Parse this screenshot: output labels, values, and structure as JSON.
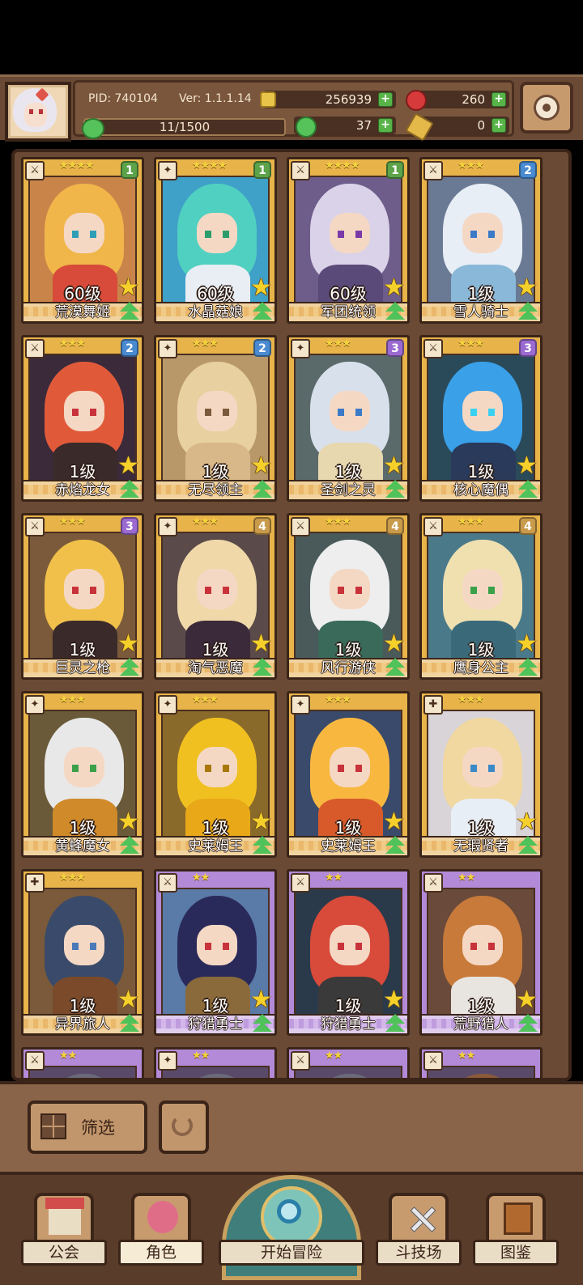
{
  "player": {
    "pid": "PID: 740104",
    "version": "Ver: 1.1.1.14",
    "stamina": "11/1500"
  },
  "resources": {
    "gold": "256939",
    "ruby": "260",
    "clover": "37",
    "key": "0"
  },
  "cards": [
    {
      "name": "荒漠舞姬",
      "level": "60级",
      "stars": "★★★★",
      "badge": "1",
      "badge_color": "#5da34a",
      "frame": "gold",
      "hair": "#f0b64a",
      "body": "#d84a3a",
      "eye": "#2f9fb8",
      "bg": "#c9844a",
      "icon": "⚔"
    },
    {
      "name": "水晶菇娘",
      "level": "60级",
      "stars": "★★★★",
      "badge": "1",
      "badge_color": "#5da34a",
      "frame": "gold",
      "hair": "#4fd0c0",
      "body": "#e8eef4",
      "eye": "#2a9d6a",
      "bg": "#3fa0c8",
      "icon": "✦"
    },
    {
      "name": "军团统领",
      "level": "60级",
      "stars": "★★★★",
      "badge": "1",
      "badge_color": "#5da34a",
      "frame": "gold",
      "hair": "#d9d2e8",
      "body": "#5a4a7a",
      "eye": "#7a3aa8",
      "bg": "#6e5d8a",
      "icon": "⚔"
    },
    {
      "name": "雪人骑士",
      "level": "1级",
      "stars": "★★★",
      "badge": "2",
      "badge_color": "#4a8ad0",
      "frame": "gold",
      "hair": "#e8eef6",
      "body": "#8ab8d8",
      "eye": "#3a7ac8",
      "bg": "#6a7a94",
      "icon": "⚔"
    },
    {
      "name": "赤焰龙女",
      "level": "1级",
      "stars": "★★★",
      "badge": "2",
      "badge_color": "#4a8ad0",
      "frame": "gold",
      "hair": "#e05a3a",
      "body": "#3a2a2a",
      "eye": "#c8323a",
      "bg": "#3a2a3a",
      "icon": "⚔"
    },
    {
      "name": "无尽领主",
      "level": "1级",
      "stars": "★★★",
      "badge": "2",
      "badge_color": "#4a8ad0",
      "frame": "gold",
      "hair": "#e8d0a0",
      "body": "#d8b888",
      "eye": "#7a5a3a",
      "bg": "#b89868",
      "icon": "✦"
    },
    {
      "name": "圣剑之灵",
      "level": "1级",
      "stars": "★★★",
      "badge": "3",
      "badge_color": "#9a6ad0",
      "frame": "gold",
      "hair": "#d8e0ec",
      "body": "#e8d8b0",
      "eye": "#3a7ac8",
      "bg": "#5a6a6a",
      "icon": "✦"
    },
    {
      "name": "核心魔偶",
      "level": "1级",
      "stars": "★★★",
      "badge": "3",
      "badge_color": "#9a6ad0",
      "frame": "gold",
      "hair": "#3aa0e8",
      "body": "#2a3a5a",
      "eye": "#3ad0f0",
      "bg": "#2a4a5a",
      "icon": "⚔"
    },
    {
      "name": "巨灵之枪",
      "level": "1级",
      "stars": "★★★",
      "badge": "3",
      "badge_color": "#9a6ad0",
      "frame": "gold",
      "hair": "#f0c04a",
      "body": "#3a2a2a",
      "eye": "#c8323a",
      "bg": "#7a5a3a",
      "icon": "⚔"
    },
    {
      "name": "淘气恶魔",
      "level": "1级",
      "stars": "★★★",
      "badge": "4",
      "badge_color": "#c89a4a",
      "frame": "gold",
      "hair": "#f0d8a8",
      "body": "#3a2a3a",
      "eye": "#c8323a",
      "bg": "#5a4a4a",
      "icon": "✦"
    },
    {
      "name": "风行游侠",
      "level": "1级",
      "stars": "★★★",
      "badge": "4",
      "badge_color": "#c89a4a",
      "frame": "gold",
      "hair": "#eeeeee",
      "body": "#3a6a5a",
      "eye": "#c8323a",
      "bg": "#4a5a5a",
      "icon": "⚔"
    },
    {
      "name": "鹰身公主",
      "level": "1级",
      "stars": "★★★",
      "badge": "4",
      "badge_color": "#c89a4a",
      "frame": "gold",
      "hair": "#f0e0b0",
      "body": "#3a6a7a",
      "eye": "#3aa04a",
      "bg": "#4a7a8a",
      "icon": "⚔"
    },
    {
      "name": "黄蜂魔女",
      "level": "1级",
      "stars": "★★★",
      "badge": "",
      "badge_color": "",
      "frame": "gold",
      "hair": "#e8e8e8",
      "body": "#d08a2a",
      "eye": "#3aa04a",
      "bg": "#6a5a3a",
      "icon": "✦"
    },
    {
      "name": "史莱姆王",
      "level": "1级",
      "stars": "★★★",
      "badge": "",
      "badge_color": "",
      "frame": "gold",
      "hair": "#f0c020",
      "body": "#e8a818",
      "eye": "#a8780a",
      "bg": "#8a6a2a",
      "icon": "✦"
    },
    {
      "name": "史莱姆王",
      "level": "1级",
      "stars": "★★★",
      "badge": "",
      "badge_color": "",
      "frame": "gold",
      "hair": "#f8b840",
      "body": "#d85a2a",
      "eye": "#c8323a",
      "bg": "#3a4a6a",
      "icon": "✦"
    },
    {
      "name": "无瑕贤者",
      "level": "1级",
      "stars": "★★★",
      "badge": "",
      "badge_color": "",
      "frame": "gold",
      "hair": "#f0d8a0",
      "body": "#e8eef6",
      "eye": "#3a8ac8",
      "bg": "#d8d4d8",
      "icon": "✚"
    },
    {
      "name": "异界旅人",
      "level": "1级",
      "stars": "★★★",
      "badge": "",
      "badge_color": "",
      "frame": "gold",
      "hair": "#3a4a6a",
      "body": "#7a4a2a",
      "eye": "#4a7ab8",
      "bg": "#7a5a3a",
      "icon": "✚"
    },
    {
      "name": "狩猎勇士",
      "level": "1级",
      "stars": "★★",
      "badge": "",
      "badge_color": "",
      "frame": "purple",
      "hair": "#2a2a5a",
      "body": "#8a6a3a",
      "eye": "#c8323a",
      "bg": "#5a7aa8",
      "icon": "⚔"
    },
    {
      "name": "狩猎勇士",
      "level": "1级",
      "stars": "★★",
      "badge": "",
      "badge_color": "",
      "frame": "purple",
      "hair": "#d84a3a",
      "body": "#3a3a3a",
      "eye": "#c8323a",
      "bg": "#2a3a4a",
      "icon": "⚔"
    },
    {
      "name": "荒野猎人",
      "level": "1级",
      "stars": "★★",
      "badge": "",
      "badge_color": "",
      "frame": "purple",
      "hair": "#c87a3a",
      "body": "#e8e4e0",
      "eye": "#c8323a",
      "bg": "#6a4a3a",
      "icon": "⚔"
    },
    {
      "name": "",
      "level": "",
      "stars": "★★",
      "badge": "",
      "badge_color": "",
      "frame": "purple",
      "hair": "#6a6a7a",
      "body": "#4a4a5a",
      "eye": "#333",
      "bg": "#5a4a6a",
      "icon": "⚔"
    },
    {
      "name": "",
      "level": "",
      "stars": "★★",
      "badge": "",
      "badge_color": "",
      "frame": "purple",
      "hair": "#6a6a7a",
      "body": "#4a4a5a",
      "eye": "#333",
      "bg": "#5a4a6a",
      "icon": "✦"
    },
    {
      "name": "",
      "level": "",
      "stars": "★★",
      "badge": "",
      "badge_color": "",
      "frame": "purple",
      "hair": "#6a6a7a",
      "body": "#4a4a5a",
      "eye": "#333",
      "bg": "#5a4a6a",
      "icon": "⚔"
    },
    {
      "name": "",
      "level": "",
      "stars": "★★",
      "badge": "",
      "badge_color": "",
      "frame": "purple",
      "hair": "#8a5a3a",
      "body": "#4a4a5a",
      "eye": "#333",
      "bg": "#5a4a6a",
      "icon": "⚔"
    }
  ],
  "toolbar": {
    "filter_label": "筛选"
  },
  "nav": {
    "guild": "公会",
    "character": "角色",
    "adventure": "开始冒险",
    "arena": "斗技场",
    "codex": "图鉴"
  }
}
